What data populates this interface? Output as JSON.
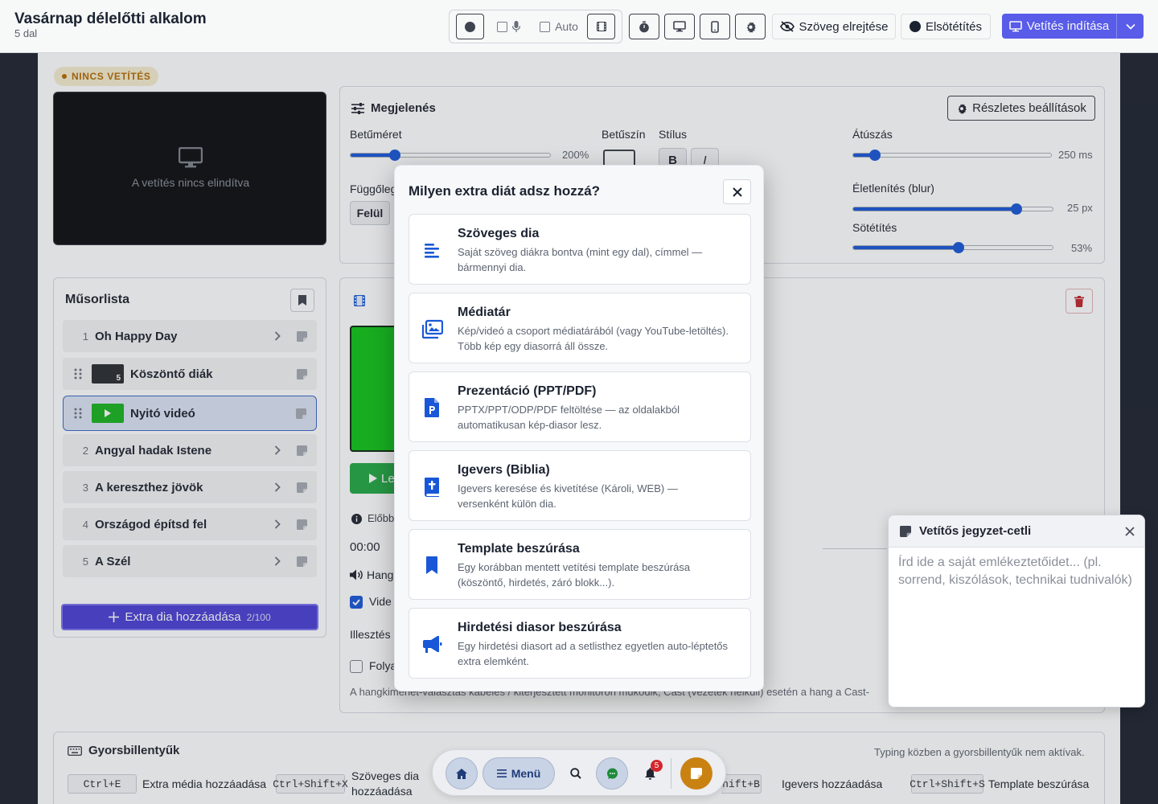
{
  "header": {
    "title": "Vasárnap délelőtti alkalom",
    "subtitle": "5 dal",
    "auto_label": "Auto",
    "hide_text_label": "Szöveg elrejtése",
    "blackout_label": "Elsötétítés",
    "start_projection_label": "Vetítés indítása"
  },
  "preview": {
    "status_badge": "NINCS VETÍTÉS",
    "empty_text": "A vetítés nincs elindítva"
  },
  "appearance": {
    "title": "Megjelenés",
    "details_button": "Részletes beállítások",
    "font_size_label": "Betűméret",
    "font_size_value": "200%",
    "font_size_level": 0.22,
    "font_color_label": "Betűszín",
    "style_label": "Stílus",
    "bold_label": "B",
    "italic_label": "I",
    "vertical_label": "Függőleg",
    "vertical_value": "Felül",
    "transition_label": "Átúszás",
    "transition_value": "250 ms",
    "transition_level": 0.11,
    "blur_label": "Életlenítés (blur)",
    "blur_value": "25 px",
    "blur_level": 0.82,
    "darken_label": "Sötétítés",
    "darken_value": "53%",
    "darken_level": 0.53
  },
  "playlist": {
    "title": "Műsorlista",
    "items": [
      {
        "num": "1",
        "name": "Oh Happy Day"
      },
      {
        "num": "",
        "name": "Köszöntő diák",
        "badge": "5"
      },
      {
        "num": "",
        "name": "Nyitó videó"
      },
      {
        "num": "2",
        "name": "Angyal hadak Istene"
      },
      {
        "num": "3",
        "name": "A kereszthez jövök"
      },
      {
        "num": "4",
        "name": "Országod építsd fel"
      },
      {
        "num": "5",
        "name": "A Szél"
      }
    ],
    "add_extra_label": "Extra dia hozzáadása",
    "add_extra_count": "2/100"
  },
  "video_panel": {
    "play_label": "Le",
    "preview_label": "Előbb",
    "time": "00:00",
    "audio_label": "Hang",
    "video_check_label": "Vide",
    "fit_label": "Illesztés",
    "loop_label": "Folya",
    "footnote": "A hangkimenet-választás kábeles / kiterjesztett monitoron működik, Cast (vezeték nélküli) esetén a hang a Cast-"
  },
  "shortcuts": {
    "title": "Gyorsbillentyűk",
    "hint": "Typing közben a gyorsbillentyűk nem aktívak.",
    "items": [
      {
        "key": "Ctrl+E",
        "label": "Extra média hozzáadása"
      },
      {
        "key": "Ctrl+Shift+X",
        "label": "Szöveges dia hozzáadása"
      },
      {
        "key": "hift+B",
        "label": "Igevers hozzáadása"
      },
      {
        "key": "Ctrl+Shift+S",
        "label": "Template beszúrása"
      }
    ]
  },
  "modal": {
    "title": "Milyen extra diát adsz hozzá?",
    "options": [
      {
        "icon": "align-left-icon",
        "title": "Szöveges dia",
        "desc": "Saját szöveg diákra bontva (mint egy dal), címmel — bármennyi dia."
      },
      {
        "icon": "images-icon",
        "title": "Médiatár",
        "desc": "Kép/videó a csoport médiatárából (vagy YouTube-letöltés). Több kép egy diasorrá áll össze."
      },
      {
        "icon": "file-powerpoint-icon",
        "title": "Prezentáció (PPT/PDF)",
        "desc": "PPTX/PPT/ODP/PDF feltöltése — az oldalakból automatikusan kép-diasor lesz."
      },
      {
        "icon": "bible-icon",
        "title": "Igevers (Biblia)",
        "desc": "Igevers keresése és kivetítése (Károli, WEB) — versenként külön dia."
      },
      {
        "icon": "bookmark-icon",
        "title": "Template beszúrása",
        "desc": "Egy korábban mentett vetítési template beszúrása (köszöntő, hirdetés, záró blokk...)."
      },
      {
        "icon": "megaphone-icon",
        "title": "Hirdetési diasor beszúrása",
        "desc": "Egy hirdetési diasort ad a setlisthez egyetlen auto-léptetős extra elemként."
      }
    ]
  },
  "note": {
    "title": "Vetítős jegyzet-cetli",
    "placeholder": "Írd ide a saját emlékeztetőidet... (pl. sorrend, kiszólások, technikai tudnivalók)"
  },
  "bottom_bar": {
    "menu_label": "Menü",
    "notification_count": "5"
  },
  "colors": {
    "accent": "#5b5cf0",
    "primary_blue": "#1957d8",
    "danger": "#c0262d",
    "status_orange": "#b26a00",
    "video_green": "#12c21a"
  }
}
